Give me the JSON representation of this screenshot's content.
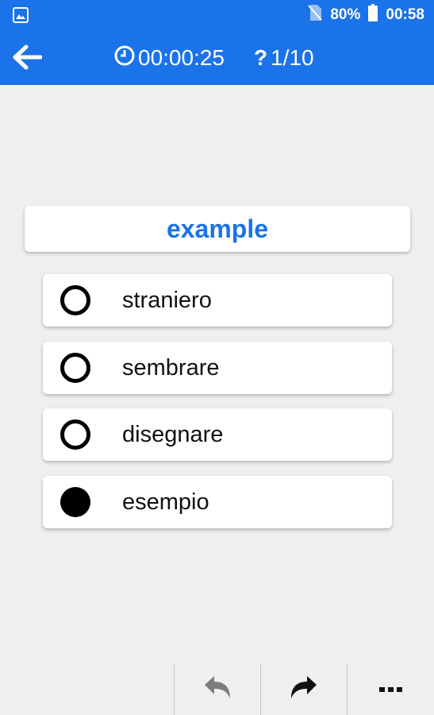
{
  "status_bar": {
    "battery_percent": "80%",
    "time": "00:58",
    "icons": [
      "image-notification-icon",
      "no-sim-icon",
      "battery-icon"
    ]
  },
  "app_bar": {
    "back_icon": "back-arrow-icon",
    "timer_icon": "clock-icon",
    "timer": "00:00:25",
    "progress_icon": "question-mark-icon",
    "progress": "1/10"
  },
  "question": {
    "word": "example"
  },
  "options": [
    {
      "label": "straniero",
      "selected": false
    },
    {
      "label": "sembrare",
      "selected": false
    },
    {
      "label": "disegnare",
      "selected": false
    },
    {
      "label": "esempio",
      "selected": true
    }
  ],
  "bottom_bar": {
    "buttons": [
      "undo-icon",
      "redo-icon",
      "more-options-icon"
    ]
  },
  "colors": {
    "accent": "#1a73e8",
    "background": "#efefef",
    "card": "#ffffff"
  }
}
